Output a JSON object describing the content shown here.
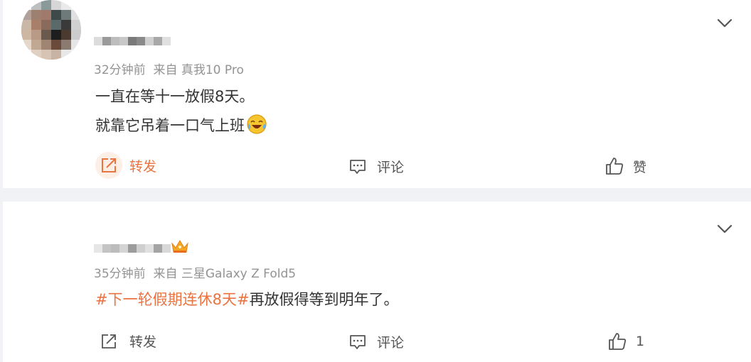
{
  "comments": [
    {
      "time": "32分钟前",
      "source": "来自 真我10 Pro",
      "lines": [
        "一直在等十一放假8天。",
        "就靠它吊着一口气上班"
      ],
      "emoji": "laugh-cry-emoji",
      "actions": {
        "repost": "转发",
        "comment": "评论",
        "like": "赞"
      },
      "accent": "#eb7340"
    },
    {
      "time": "35分钟前",
      "source": "来自 三星Galaxy Z Fold5",
      "topic": "#下一轮假期连休8天#",
      "text_after_topic": "再放假得等到明年了。",
      "actions": {
        "repost": "转发",
        "comment": "评论",
        "like": "1"
      },
      "badge": "crown-icon"
    }
  ],
  "colors": {
    "topic": "#eb7340",
    "meta": "#939393",
    "page_bg": "#f1f2f5"
  }
}
